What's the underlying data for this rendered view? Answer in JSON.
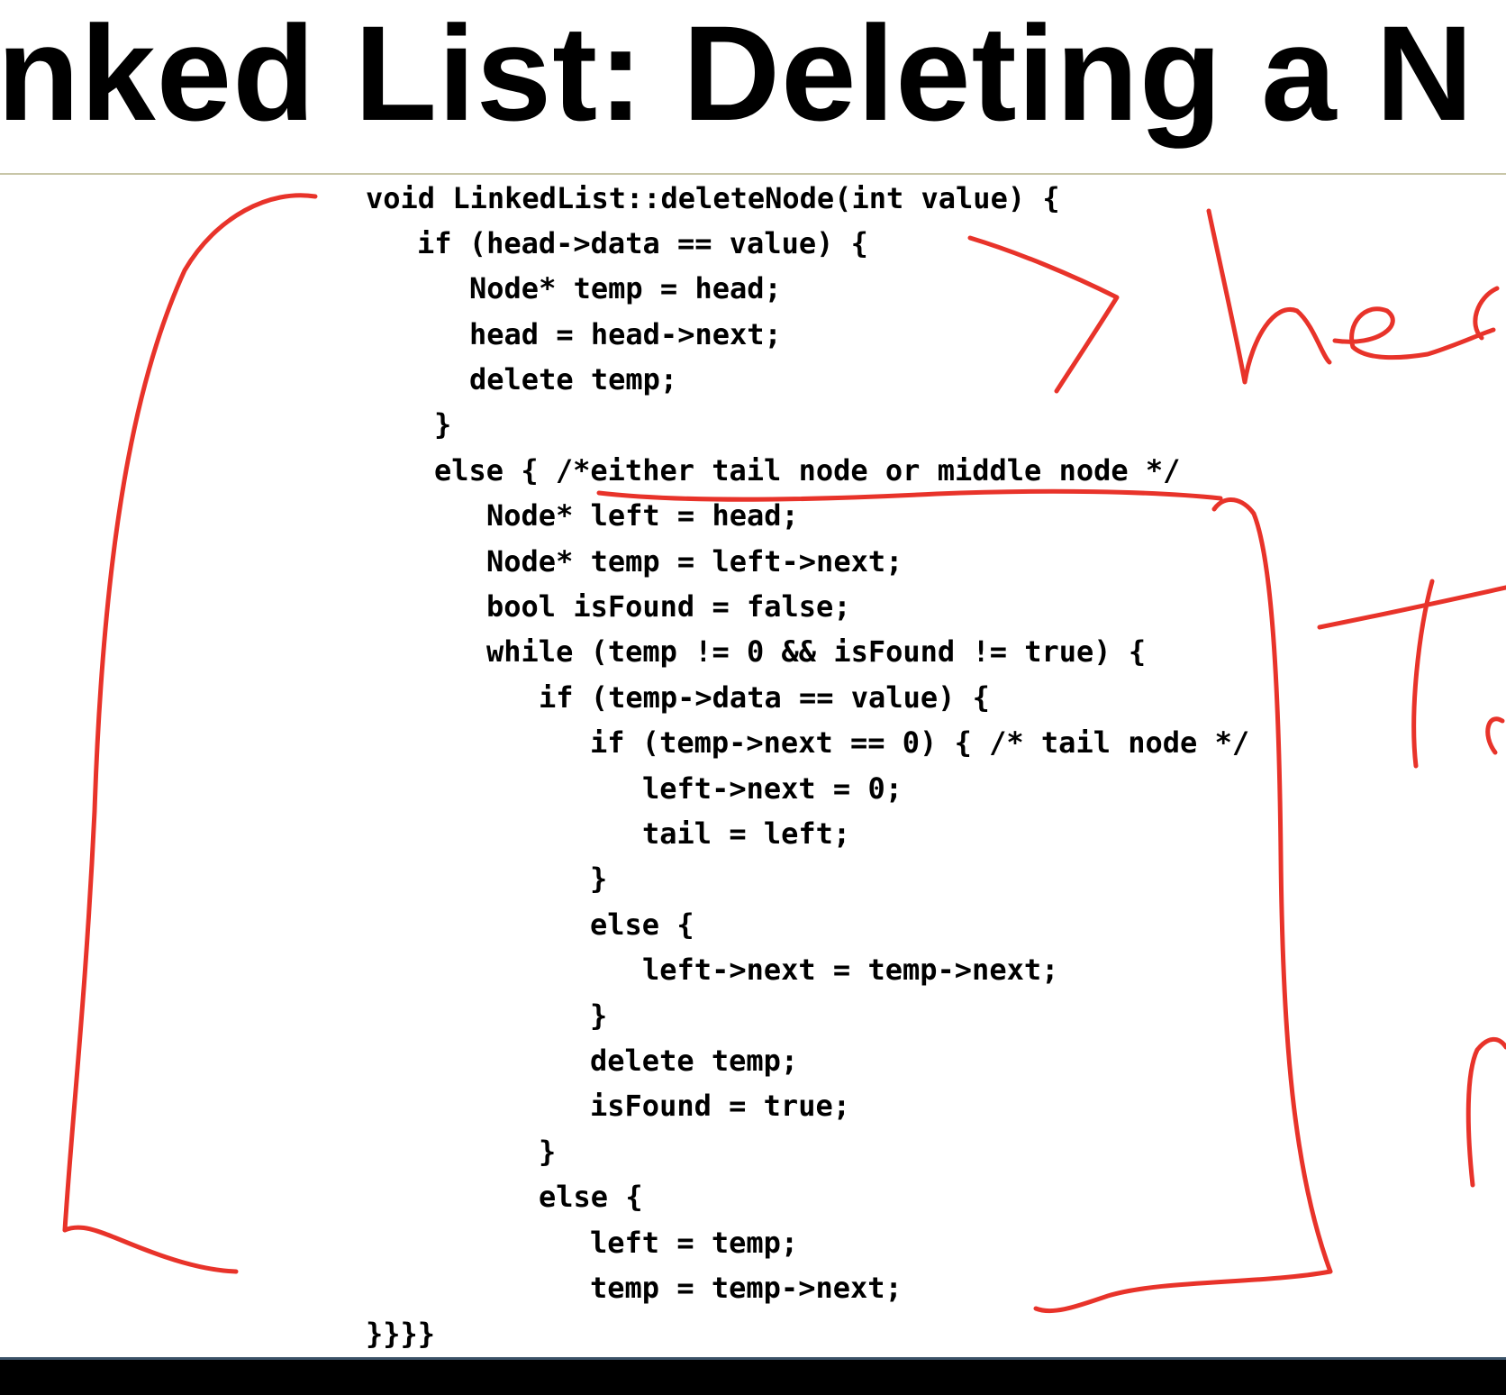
{
  "slide": {
    "title": "inked List: Deleting a N",
    "code_lines": [
      "void LinkedList::deleteNode(int value) {",
      "if (head->data == value) {",
      "Node* temp = head;",
      "head = head->next;",
      "delete temp;",
      "}",
      "else { /*either tail node or middle node */",
      "Node* left = head;",
      "Node* temp = left->next;",
      "bool isFound = false;",
      "while (temp != 0 && isFound != true) {",
      "if (temp->data == value) {",
      "if (temp->next == 0) { /* tail node */",
      "left->next = 0;",
      "tail = left;",
      "}",
      "else {",
      "left->next = temp->next;",
      "}",
      "delete temp;",
      "isFound = true;",
      "}",
      "else {",
      "left = temp;",
      "temp = temp->next;",
      "}}}}"
    ]
  },
  "annotations": {
    "ink_color": "#e8332a",
    "handwriting": [
      "hea",
      "Ta",
      "M"
    ]
  },
  "colors": {
    "background": "#ffffff",
    "text": "#000000",
    "rule": "#c8c6a8",
    "taskbar": "#000000"
  }
}
